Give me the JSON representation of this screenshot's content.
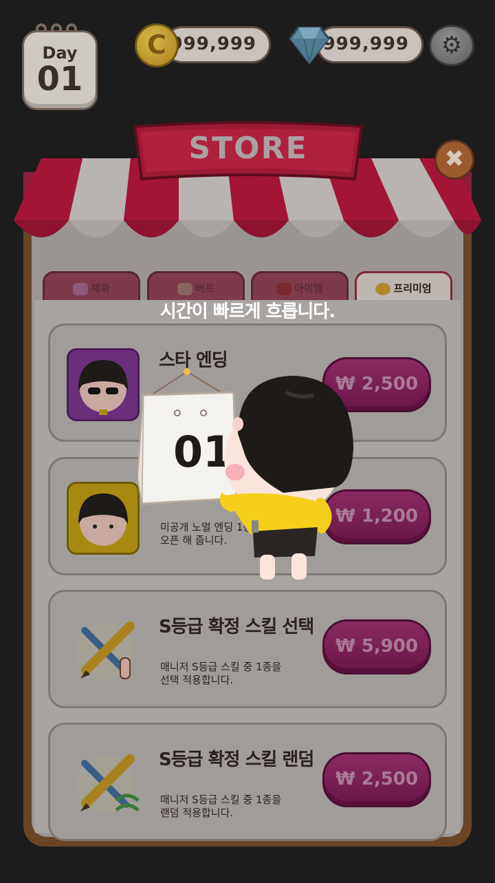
{
  "day": {
    "label": "Day",
    "number": "01"
  },
  "currency": {
    "coin_symbol": "C",
    "coin_value": "999,999",
    "gem_value": "999,999"
  },
  "settings_icon": "gear-icon",
  "store": {
    "title": "STORE",
    "close_symbol": "✖"
  },
  "tabs": [
    {
      "label": "재화",
      "icon": "currency-icon"
    },
    {
      "label": "버프",
      "icon": "muscle-icon"
    },
    {
      "label": "아이템",
      "icon": "chest-icon"
    },
    {
      "label": "프리미엄",
      "icon": "medal-icon",
      "active": true
    }
  ],
  "notice": "시간이 빠르게 흐릅니다.",
  "products": [
    {
      "title": "스타 엔딩",
      "desc": "",
      "price": "₩ 2,500",
      "icon": "star-girl-icon"
    },
    {
      "title": "",
      "desc": "미공개 노멀 엔딩 1종\n오픈 해 줍니다.",
      "price": "₩ 1,200",
      "icon": "normal-girl-icon"
    },
    {
      "title": "S등급 확정 스킬 선택",
      "desc": "매니저 S등급 스킬 중 1종을\n선택 적용합니다.",
      "price": "₩ 5,900",
      "icon": "tools-select-icon"
    },
    {
      "title": "S등급 확정 스킬 랜덤",
      "desc": "매니저 S등급 스킬 중 1종을\n랜덤 적용합니다.",
      "price": "₩ 2,500",
      "icon": "tools-random-icon"
    }
  ],
  "calendar": {
    "number": "01"
  },
  "colors": {
    "accent": "#6a1647",
    "frame": "#6b4424",
    "awning_red": "#b8123a"
  }
}
